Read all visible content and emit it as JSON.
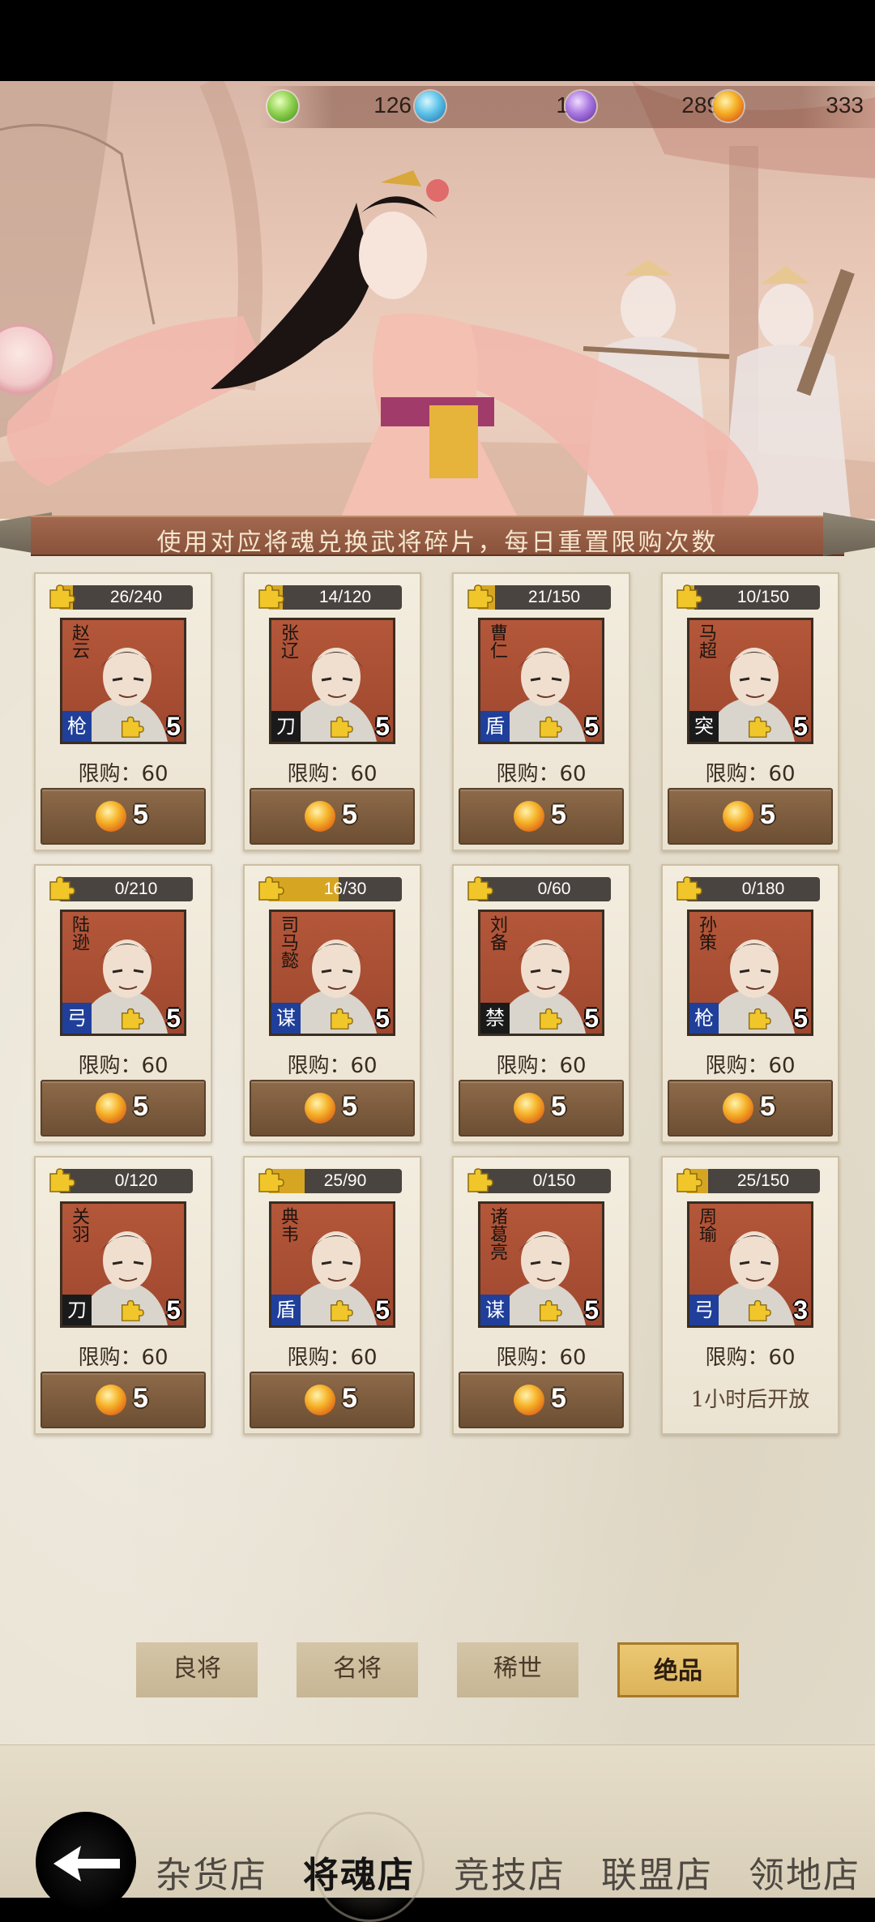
{
  "currencies": [
    {
      "icon": "green-soul-orb-icon",
      "value": "126",
      "color": "#6fbf3a"
    },
    {
      "icon": "blue-soul-orb-icon",
      "value": "1",
      "color": "#3aa3d6"
    },
    {
      "icon": "purple-soul-orb-icon",
      "value": "289",
      "color": "#9a5ad6"
    },
    {
      "icon": "orange-soul-orb-icon",
      "value": "333",
      "color": "#f29a1e"
    }
  ],
  "notice": "使用对应将魂兑换武将碎片，每日重置限购次数",
  "limit_label": "限购：60",
  "heroes": [
    {
      "name": "赵云",
      "type": "枪",
      "type_color": "#1f3f9a",
      "fragments": "26/240",
      "progress": 0.108,
      "stars": "5",
      "price": "5",
      "locked": false
    },
    {
      "name": "张辽",
      "type": "刀",
      "type_color": "#1a1a1a",
      "fragments": "14/120",
      "progress": 0.117,
      "stars": "5",
      "price": "5",
      "locked": false
    },
    {
      "name": "曹仁",
      "type": "盾",
      "type_color": "#1f3f9a",
      "fragments": "21/150",
      "progress": 0.14,
      "stars": "5",
      "price": "5",
      "locked": false
    },
    {
      "name": "马超",
      "type": "突",
      "type_color": "#1a1a1a",
      "fragments": "10/150",
      "progress": 0.067,
      "stars": "5",
      "price": "5",
      "locked": false
    },
    {
      "name": "陆逊",
      "type": "弓",
      "type_color": "#1f3f9a",
      "fragments": "0/210",
      "progress": 0,
      "stars": "5",
      "price": "5",
      "locked": false
    },
    {
      "name": "司马懿",
      "type": "谋",
      "type_color": "#1f3f9a",
      "fragments": "16/30",
      "progress": 0.533,
      "stars": "5",
      "price": "5",
      "locked": false
    },
    {
      "name": "刘备",
      "type": "禁",
      "type_color": "#1a1a1a",
      "fragments": "0/60",
      "progress": 0,
      "stars": "5",
      "price": "5",
      "locked": false
    },
    {
      "name": "孙策",
      "type": "枪",
      "type_color": "#1f3f9a",
      "fragments": "0/180",
      "progress": 0,
      "stars": "5",
      "price": "5",
      "locked": false
    },
    {
      "name": "关羽",
      "type": "刀",
      "type_color": "#1a1a1a",
      "fragments": "0/120",
      "progress": 0,
      "stars": "5",
      "price": "5",
      "locked": false
    },
    {
      "name": "典韦",
      "type": "盾",
      "type_color": "#1f3f9a",
      "fragments": "25/90",
      "progress": 0.278,
      "stars": "5",
      "price": "5",
      "locked": false
    },
    {
      "name": "诸葛亮",
      "type": "谋",
      "type_color": "#1f3f9a",
      "fragments": "0/150",
      "progress": 0,
      "stars": "5",
      "price": "5",
      "locked": false
    },
    {
      "name": "周瑜",
      "type": "弓",
      "type_color": "#1f3f9a",
      "fragments": "25/150",
      "progress": 0.167,
      "stars": "3",
      "price": "",
      "locked": true,
      "locked_label": "1小时后开放"
    }
  ],
  "tiers": [
    {
      "label": "良将",
      "active": false
    },
    {
      "label": "名将",
      "active": false
    },
    {
      "label": "稀世",
      "active": false
    },
    {
      "label": "绝品",
      "active": true
    }
  ],
  "nav": [
    {
      "label": "杂货店",
      "active": false
    },
    {
      "label": "将魂店",
      "active": true
    },
    {
      "label": "竞技店",
      "active": false
    },
    {
      "label": "联盟店",
      "active": false
    },
    {
      "label": "领地店",
      "active": false
    }
  ],
  "icons": {
    "back": "back-arrow-icon",
    "fragment": "puzzle-piece-icon",
    "price": "orange-soul-orb-icon"
  },
  "colors": {
    "accent_gold": "#dcb35a",
    "card_bg": "#f3eddf",
    "button_brown": "#7a5a3c"
  }
}
